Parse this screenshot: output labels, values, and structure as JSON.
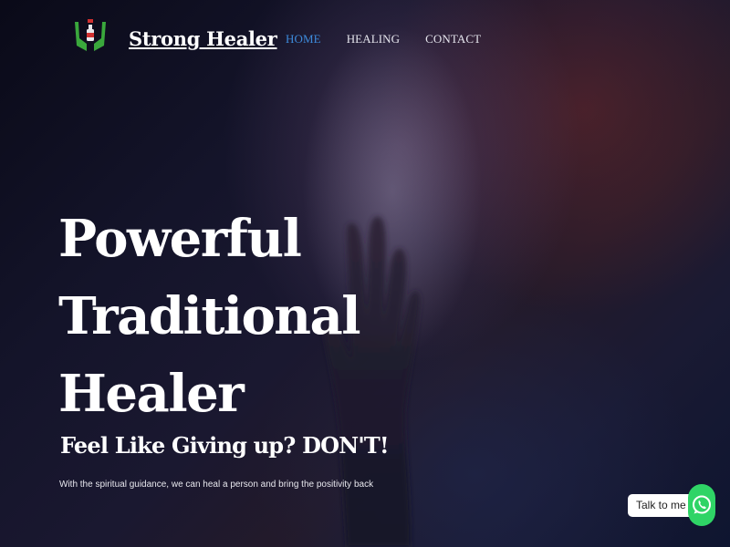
{
  "header": {
    "brand": "Strong Healer",
    "logo_icon": "healing-hands-logo-icon",
    "nav": [
      {
        "label": "HOME",
        "active": true
      },
      {
        "label": "HEALING",
        "active": false
      },
      {
        "label": "CONTACT",
        "active": false
      }
    ]
  },
  "hero": {
    "title_lines": [
      "Powerful",
      "Traditional",
      "Healer"
    ],
    "subtitle": "Feel Like Giving up? DON'T!",
    "description": "With the spiritual guidance, we can heal a person and bring the positivity back"
  },
  "chat_widget": {
    "label": "Talk to me",
    "icon": "whatsapp-icon",
    "color": "#2fd466"
  },
  "colors": {
    "nav_active": "#3d8bdc",
    "text": "#ffffff"
  }
}
